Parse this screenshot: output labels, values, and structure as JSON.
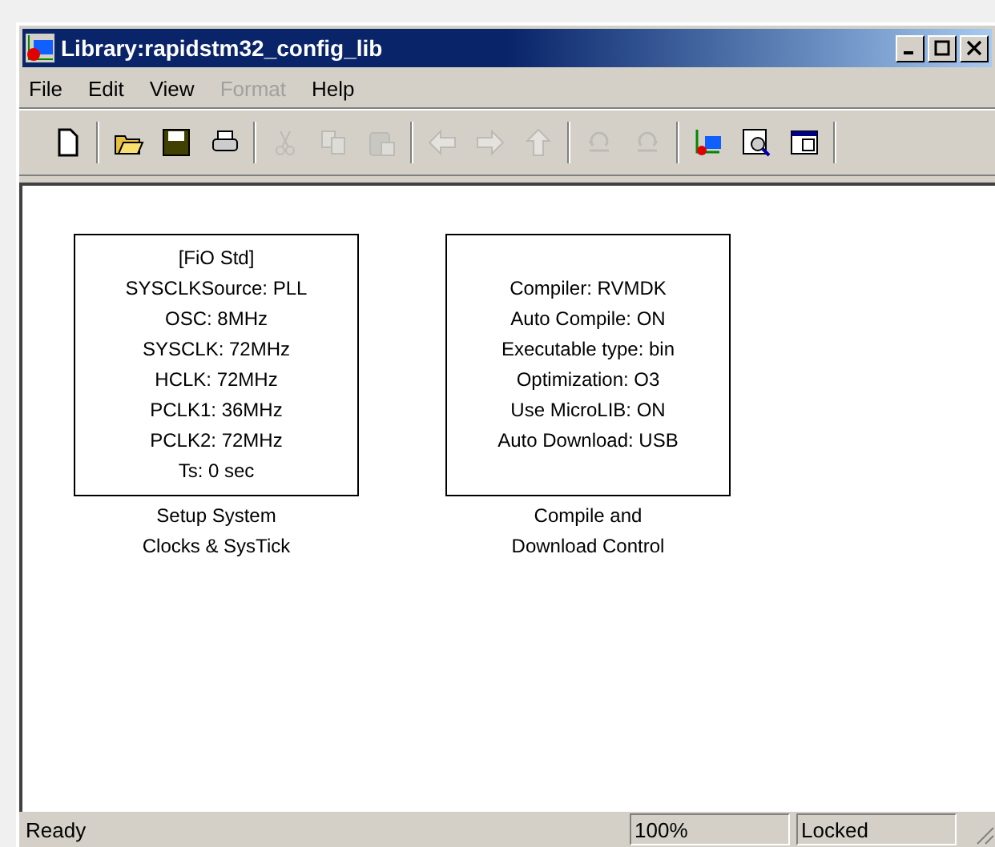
{
  "window": {
    "title": "Library:rapidstm32_config_lib"
  },
  "menu": [
    {
      "label": "File",
      "disabled": false
    },
    {
      "label": "Edit",
      "disabled": false
    },
    {
      "label": "View",
      "disabled": false
    },
    {
      "label": "Format",
      "disabled": true
    },
    {
      "label": "Help",
      "disabled": false
    }
  ],
  "toolbar": [
    [
      {
        "disabled": false
      }
    ],
    [
      {
        "disabled": false
      },
      {
        "disabled": false
      },
      {
        "disabled": false
      }
    ],
    [
      {
        "disabled": true
      },
      {
        "disabled": true
      },
      {
        "disabled": true
      }
    ],
    [
      {
        "disabled": true
      },
      {
        "disabled": true
      },
      {
        "disabled": true
      }
    ],
    [
      {
        "disabled": true
      },
      {
        "disabled": true
      }
    ],
    [
      {
        "disabled": false
      },
      {
        "disabled": false
      },
      {
        "disabled": false
      }
    ]
  ],
  "blocks": [
    {
      "lines": [
        "[FiO Std]",
        "SYSCLKSource: PLL",
        "OSC: 8MHz",
        "SYSCLK: 72MHz",
        "HCLK: 72MHz",
        "PCLK1: 36MHz",
        "PCLK2: 72MHz",
        "Ts: 0 sec"
      ],
      "caption": [
        "Setup System",
        "Clocks & SysTick"
      ]
    },
    {
      "lines": [
        "Compiler: RVMDK",
        "Auto Compile: ON",
        "Executable type: bin",
        "Optimization: O3",
        "Use MicroLIB: ON",
        "Auto Download: USB"
      ],
      "caption": [
        "Compile and",
        "Download Control"
      ]
    }
  ],
  "status_bar": {
    "message": "Ready",
    "zoom": "100%",
    "lock": "Locked"
  }
}
